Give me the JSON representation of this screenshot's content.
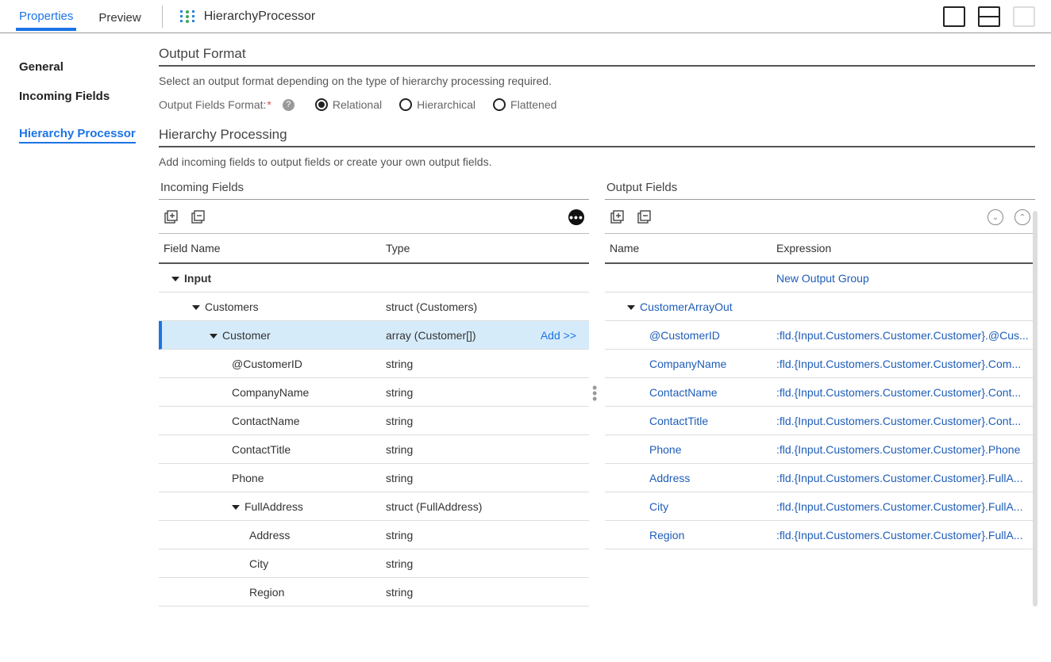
{
  "topbar": {
    "tabs": {
      "properties": "Properties",
      "preview": "Preview"
    },
    "proc_name": "HierarchyProcessor"
  },
  "sidebar": {
    "general": "General",
    "incoming": "Incoming Fields",
    "hproc": "Hierarchy Processor"
  },
  "output_format": {
    "title": "Output Format",
    "desc": "Select an output format depending on the type of hierarchy processing required.",
    "label": "Output Fields Format:",
    "options": {
      "relational": "Relational",
      "hierarchical": "Hierarchical",
      "flattened": "Flattened"
    }
  },
  "processing": {
    "title": "Hierarchy Processing",
    "desc": "Add incoming fields to output fields or create your own output fields."
  },
  "incoming": {
    "title": "Incoming Fields",
    "col_field": "Field Name",
    "col_type": "Type",
    "add_label": "Add >>",
    "rows": [
      {
        "name": "Input",
        "type": "",
        "bold": true,
        "caret": true,
        "indent": 1
      },
      {
        "name": "Customers",
        "type": "struct (Customers)",
        "caret": true,
        "indent": 2
      },
      {
        "name": "Customer",
        "type": "array (Customer[])",
        "caret": true,
        "indent": 3,
        "selected": true,
        "add": true
      },
      {
        "name": "@CustomerID",
        "type": "string",
        "indent": 4
      },
      {
        "name": "CompanyName",
        "type": "string",
        "indent": 4
      },
      {
        "name": "ContactName",
        "type": "string",
        "indent": 4
      },
      {
        "name": "ContactTitle",
        "type": "string",
        "indent": 4
      },
      {
        "name": "Phone",
        "type": "string",
        "indent": 4
      },
      {
        "name": "FullAddress",
        "type": "struct (FullAddress)",
        "caret": true,
        "indent": 4
      },
      {
        "name": "Address",
        "type": "string",
        "indent": 5
      },
      {
        "name": "City",
        "type": "string",
        "indent": 5
      },
      {
        "name": "Region",
        "type": "string",
        "indent": 5
      }
    ]
  },
  "output": {
    "title": "Output Fields",
    "col_name": "Name",
    "col_expr": "Expression",
    "new_group": "New Output Group",
    "rows": [
      {
        "name": "",
        "expr": "New Output Group",
        "indent": 1,
        "exprlink": true,
        "namehide": true
      },
      {
        "name": "CustomerArrayOut",
        "expr": "",
        "caret": true,
        "indent": 2,
        "namelink": true
      },
      {
        "name": "@CustomerID",
        "expr": ":fld.{Input.Customers.Customer.Customer}.@Cus...",
        "indent": 3,
        "namelink": true
      },
      {
        "name": "CompanyName",
        "expr": ":fld.{Input.Customers.Customer.Customer}.Com...",
        "indent": 3,
        "namelink": true
      },
      {
        "name": "ContactName",
        "expr": ":fld.{Input.Customers.Customer.Customer}.Cont...",
        "indent": 3,
        "namelink": true
      },
      {
        "name": "ContactTitle",
        "expr": ":fld.{Input.Customers.Customer.Customer}.Cont...",
        "indent": 3,
        "namelink": true
      },
      {
        "name": "Phone",
        "expr": ":fld.{Input.Customers.Customer.Customer}.Phone",
        "indent": 3,
        "namelink": true
      },
      {
        "name": "Address",
        "expr": ":fld.{Input.Customers.Customer.Customer}.FullA...",
        "indent": 3,
        "namelink": true
      },
      {
        "name": "City",
        "expr": ":fld.{Input.Customers.Customer.Customer}.FullA...",
        "indent": 3,
        "namelink": true
      },
      {
        "name": "Region",
        "expr": ":fld.{Input.Customers.Customer.Customer}.FullA...",
        "indent": 3,
        "namelink": true
      }
    ]
  }
}
